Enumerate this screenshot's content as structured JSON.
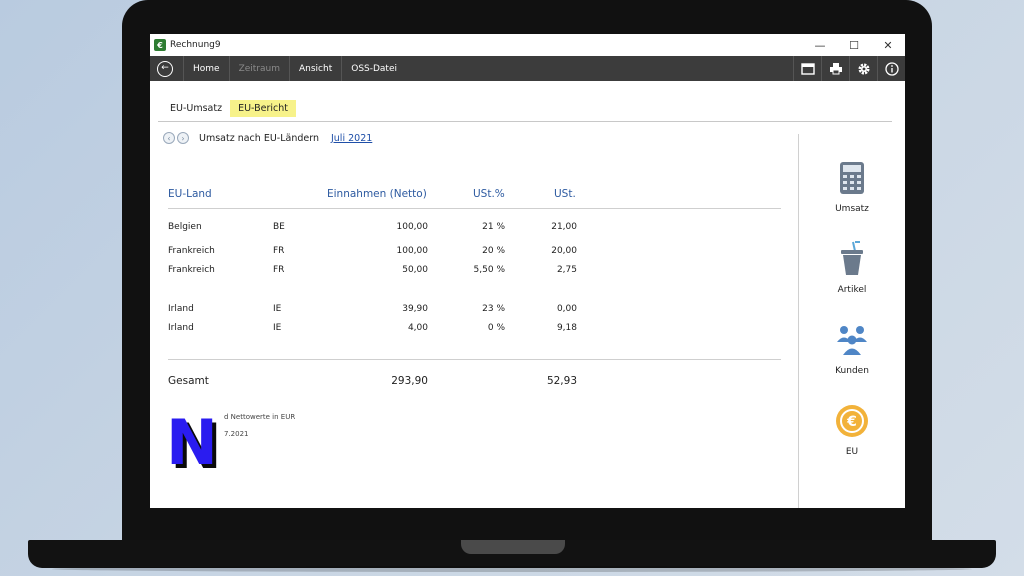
{
  "window": {
    "title": "Rechnung9",
    "app_logo_char": "€",
    "minimize_glyph": "—",
    "maximize_glyph": "☐",
    "close_glyph": "✕"
  },
  "toolbar": {
    "back_glyph": "←",
    "items": [
      "Home",
      "Zeitraum",
      "Ansicht",
      "OSS-Datei"
    ],
    "icons": [
      "window-icon",
      "print-icon",
      "gear-icon",
      "info-icon"
    ]
  },
  "tabs": [
    "EU-Umsatz",
    "EU-Bericht"
  ],
  "nav": {
    "prev_glyph": "‹",
    "next_glyph": "›",
    "title": "Umsatz nach EU-Ländern",
    "month": "Juli 2021"
  },
  "table": {
    "headers": [
      "EU-Land",
      "Einnahmen (Netto)",
      "USt.%",
      "USt."
    ],
    "rows": [
      {
        "land": "Belgien",
        "code": "BE",
        "netto": "100,00",
        "pct": "21 %",
        "ust": "21,00"
      },
      {
        "land": "Frankreich",
        "code": "FR",
        "netto": "100,00",
        "pct": "20 %",
        "ust": "20,00"
      },
      {
        "land": "Frankreich",
        "code": "FR",
        "netto": "50,00",
        "pct": "5,50 %",
        "ust": "2,75"
      },
      {
        "land": "Irland",
        "code": "IE",
        "netto": "39,90",
        "pct": "23 %",
        "ust": "0,00"
      },
      {
        "land": "Irland",
        "code": "IE",
        "netto": "4,00",
        "pct": "0 %",
        "ust": "9,18"
      }
    ],
    "total_label": "Gesamt",
    "total_netto": "293,90",
    "total_ust": "52,93"
  },
  "notes": {
    "line1": "d Nettowerte in EUR",
    "line2": "7.2021"
  },
  "overlay_letter": "N",
  "sidebar": {
    "items": [
      {
        "label": "Umsatz",
        "icon": "calculator-icon"
      },
      {
        "label": "Artikel",
        "icon": "cup-icon"
      },
      {
        "label": "Kunden",
        "icon": "people-icon"
      },
      {
        "label": "EU",
        "icon": "euro-coin-icon"
      }
    ]
  },
  "colors": {
    "header_blue": "#2d5aa0",
    "tab_highlight": "#f7f28a",
    "toolbar_bg": "#3c3c3c",
    "euro_coin": "#f2b23a"
  }
}
